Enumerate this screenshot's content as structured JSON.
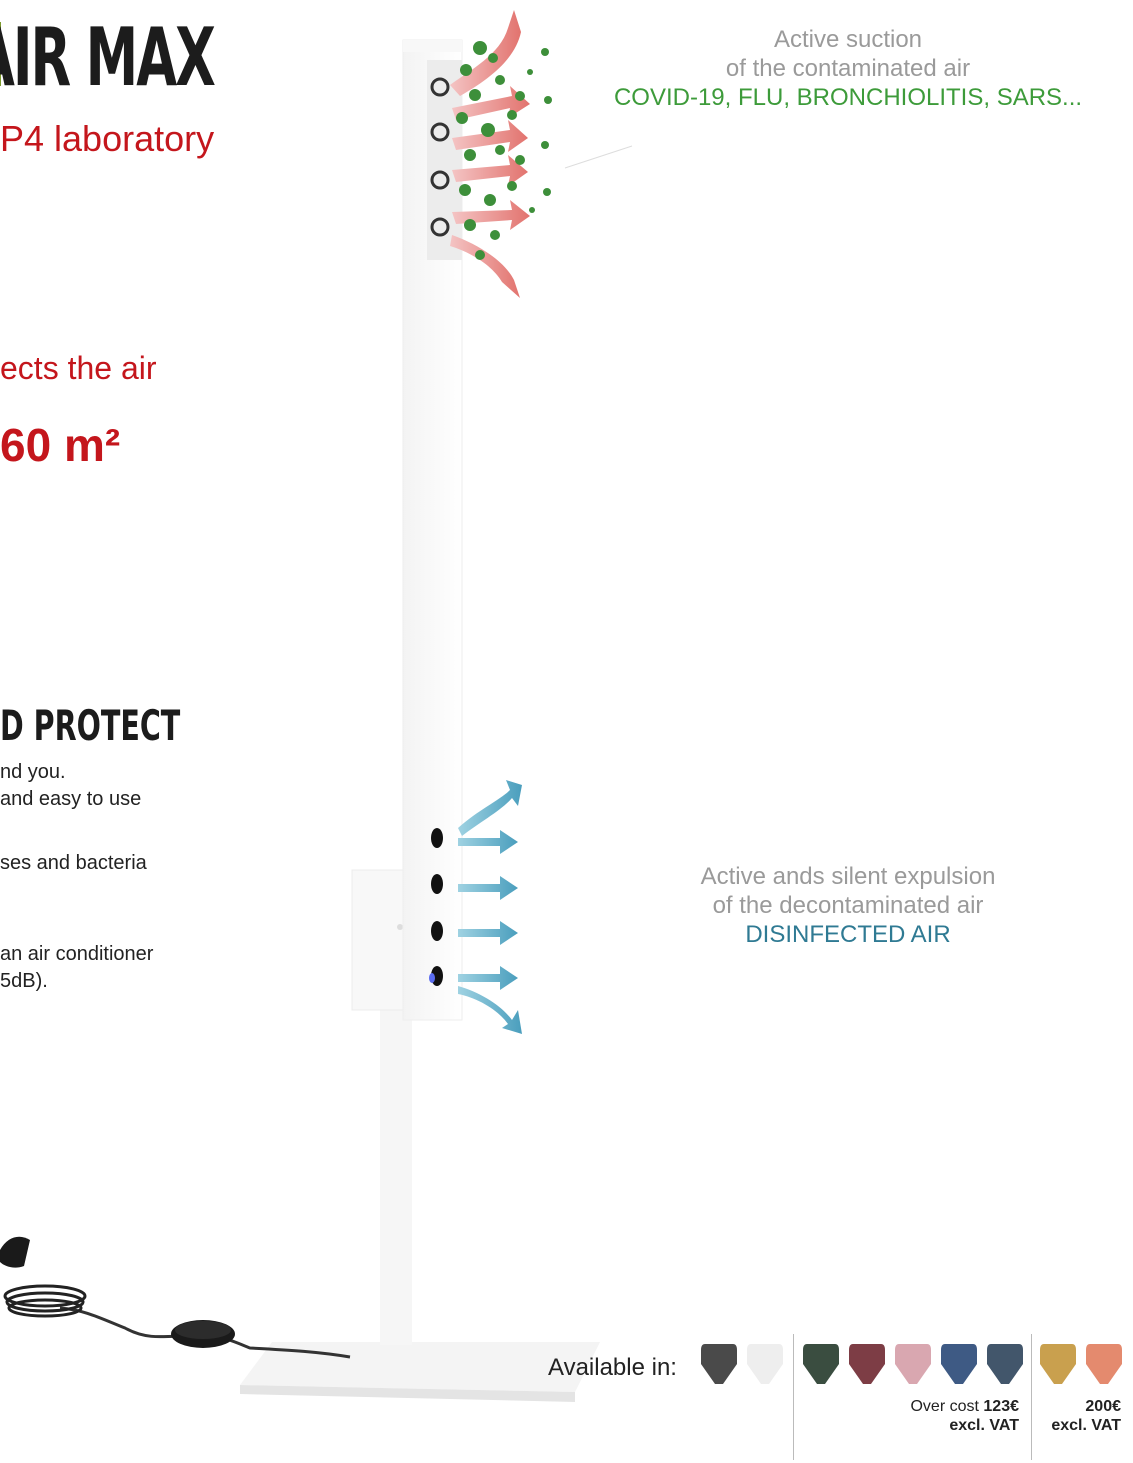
{
  "header": {
    "title": "AIR MAX",
    "subtitle": "P4 laboratory"
  },
  "specs": {
    "disinfects": "ects the air",
    "area": "60 m²"
  },
  "section": {
    "heading": "D PROTECT",
    "lines": [
      "nd you.",
      "and easy to use",
      "ses and bacteria",
      "an air conditioner",
      "5dB)."
    ]
  },
  "suction": {
    "line1": "Active suction",
    "line2": "of the contaminated air",
    "line3": "COVID-19, FLU, BRONCHIOLITIS, SARS..."
  },
  "expulsion": {
    "line1": "Active ands silent expulsion",
    "line2": "of the decontaminated air",
    "line3": "DISINFECTED AIR"
  },
  "colors": {
    "label": "Available in:",
    "standard": [
      "#4a4a4a",
      "#eeeeee"
    ],
    "overcost": [
      "#3a4d40",
      "#7d3d45",
      "#d9a7b0",
      "#3e5a84",
      "#42566b"
    ],
    "premium": [
      "#c9a04e",
      "#e48a6e"
    ],
    "overcost_note": {
      "prefix": "Over cost",
      "price": "123€",
      "vat": "excl. VAT"
    },
    "premium_note": {
      "price": "200€",
      "vat": "excl. VAT"
    }
  },
  "palette": {
    "accent_red": "#c4161c",
    "virus_green": "#3d9b3a",
    "clean_teal": "#2f7a93"
  }
}
